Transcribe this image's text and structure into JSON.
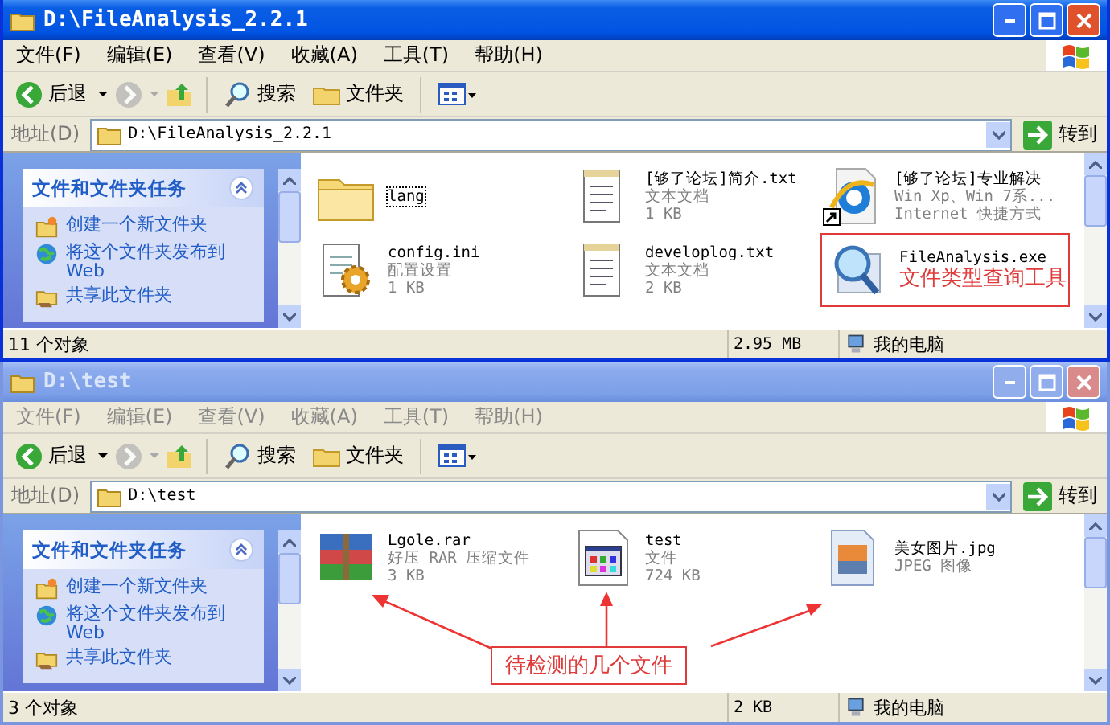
{
  "windows": [
    {
      "title": "D:\\FileAnalysis_2.2.1",
      "active": true,
      "menu": [
        "文件(F)",
        "编辑(E)",
        "查看(V)",
        "收藏(A)",
        "工具(T)",
        "帮助(H)"
      ],
      "toolbar": {
        "back": "后退",
        "search": "搜索",
        "folders": "文件夹"
      },
      "address": {
        "label": "地址(D)",
        "value": "D:\\FileAnalysis_2.2.1",
        "go": "转到"
      },
      "tasks": {
        "title": "文件和文件夹任务",
        "items": [
          {
            "kind": "new-folder",
            "label": "创建一个新文件夹"
          },
          {
            "kind": "publish",
            "label": "将这个文件夹发布到 Web"
          },
          {
            "kind": "share",
            "label": "共享此文件夹"
          }
        ]
      },
      "files": [
        {
          "kind": "folder",
          "name": "lang",
          "selected": true,
          "highlighted": false
        },
        {
          "kind": "text",
          "name": "[够了论坛]简介.txt",
          "type": "文本文档",
          "size": "1 KB",
          "highlighted": false
        },
        {
          "kind": "shortcut",
          "name": "[够了论坛]专业解决",
          "type": "Win Xp、Win 7系...",
          "size": "Internet 快捷方式",
          "highlighted": false
        },
        {
          "kind": "config",
          "name": "config.ini",
          "type": "配置设置",
          "size": "1 KB",
          "highlighted": false
        },
        {
          "kind": "text",
          "name": "developlog.txt",
          "type": "文本文档",
          "size": "2 KB",
          "highlighted": false
        },
        {
          "kind": "exe",
          "name": "FileAnalysis.exe",
          "note": "文件类型查询工具",
          "highlighted": true
        }
      ],
      "status": {
        "count": "11 个对象",
        "size": "2.95 MB",
        "zone": "我的电脑"
      }
    },
    {
      "title": "D:\\test",
      "active": false,
      "menu": [
        "文件(F)",
        "编辑(E)",
        "查看(V)",
        "收藏(A)",
        "工具(T)",
        "帮助(H)"
      ],
      "toolbar": {
        "back": "后退",
        "search": "搜索",
        "folders": "文件夹"
      },
      "address": {
        "label": "地址(D)",
        "value": "D:\\test",
        "go": "转到"
      },
      "tasks": {
        "title": "文件和文件夹任务",
        "items": [
          {
            "kind": "new-folder",
            "label": "创建一个新文件夹"
          },
          {
            "kind": "publish",
            "label": "将这个文件夹发布到 Web"
          },
          {
            "kind": "share",
            "label": "共享此文件夹"
          }
        ]
      },
      "files": [
        {
          "kind": "archive",
          "name": "Lgole.rar",
          "type": "好压 RAR 压缩文件",
          "size": "3 KB",
          "highlighted": false
        },
        {
          "kind": "app",
          "name": "test",
          "type": "文件",
          "size": "724 KB",
          "highlighted": false
        },
        {
          "kind": "image",
          "name": "美女图片.jpg",
          "type": "JPEG 图像",
          "highlighted": false
        }
      ],
      "callout": "待检测的几个文件",
      "status": {
        "count": "3 个对象",
        "size": "2 KB",
        "zone": "我的电脑"
      }
    }
  ]
}
